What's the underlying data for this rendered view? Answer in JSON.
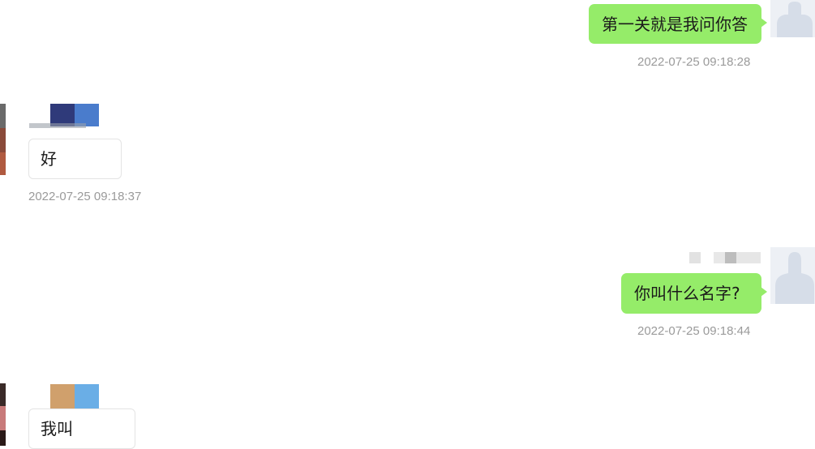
{
  "chat": {
    "messages": [
      {
        "side": "right",
        "text": "第一关就是我问你答",
        "time": "2022-07-25 09:18:28"
      },
      {
        "side": "left",
        "text": "好",
        "time": "2022-07-25 09:18:37"
      },
      {
        "side": "right",
        "text": "你叫什么名字?",
        "time": "2022-07-25 09:18:44"
      },
      {
        "side": "left",
        "text": "我叫",
        "time": ""
      }
    ]
  }
}
